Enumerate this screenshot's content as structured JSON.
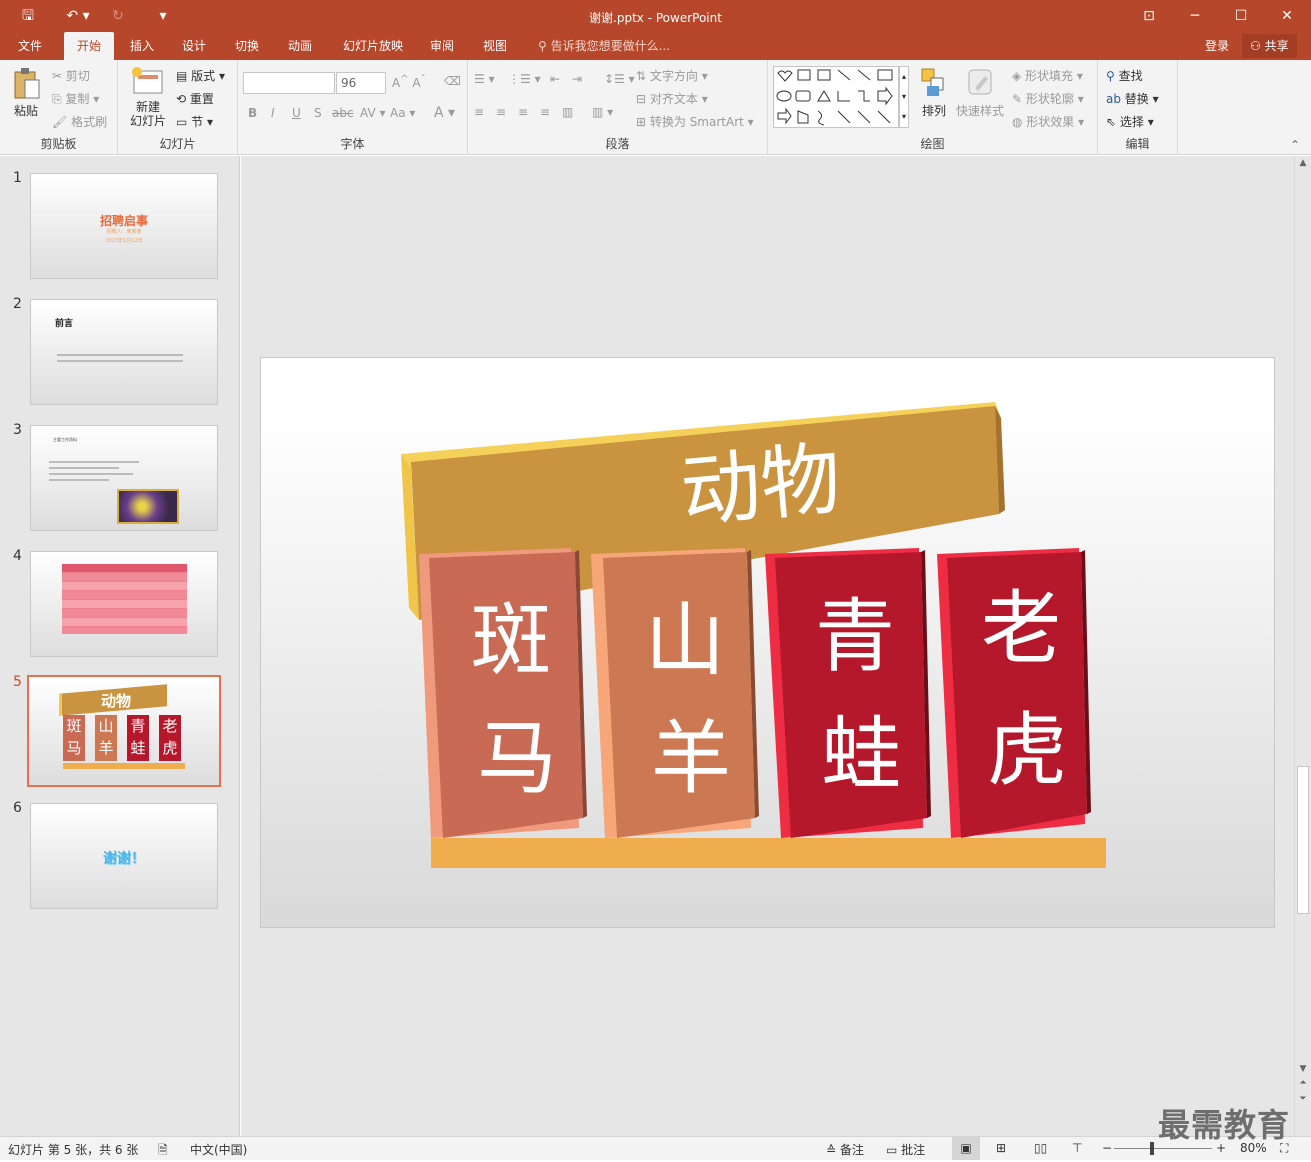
{
  "window": {
    "title": "谢谢.pptx - PowerPoint",
    "qat": {
      "save": "🖫",
      "undo": "↶ ▾",
      "redo": "↻",
      "customize": "▾"
    },
    "controls": {
      "ribbon_display": "⊡",
      "minimize": "─",
      "maximize": "☐",
      "close": "✕"
    }
  },
  "menu": {
    "tabs": [
      "文件",
      "开始",
      "插入",
      "设计",
      "切换",
      "动画",
      "幻灯片放映",
      "审阅",
      "视图"
    ],
    "active": "开始",
    "tell_me": "告诉我您想要做什么...",
    "login": "登录",
    "share": "共享"
  },
  "ribbon": {
    "clipboard": {
      "label": "剪贴板",
      "paste": "粘贴",
      "cut": "剪切",
      "copy": "复制",
      "format_painter": "格式刷"
    },
    "slides": {
      "label": "幻灯片",
      "new_slide": "新建\n幻灯片",
      "layout": "版式",
      "reset": "重置",
      "section": "节"
    },
    "font": {
      "label": "字体",
      "font_name": "",
      "font_size": "96"
    },
    "paragraph": {
      "label": "段落",
      "text_direction": "文字方向",
      "align_text": "对齐文本",
      "convert_smartart": "转换为 SmartArt"
    },
    "drawing": {
      "label": "绘图",
      "arrange": "排列",
      "quick_styles": "快速样式",
      "shape_fill": "形状填充",
      "shape_outline": "形状轮廓",
      "shape_effects": "形状效果"
    },
    "editing": {
      "label": "编辑",
      "find": "查找",
      "replace": "替换",
      "select": "选择"
    }
  },
  "thumbnails": [
    {
      "num": "1",
      "title": "招聘启事",
      "line1": "招聘人：某某某",
      "line2": "2023年1月12日"
    },
    {
      "num": "2",
      "title": "前言"
    },
    {
      "num": "3",
      "title": "主要工作资料"
    },
    {
      "num": "4",
      "title": "表格"
    },
    {
      "num": "5",
      "title": "动物",
      "cards": [
        "斑马",
        "山羊",
        "青蛙",
        "老虎"
      ]
    },
    {
      "num": "6",
      "title": "谢谢！"
    }
  ],
  "selected_slide": "5",
  "slide": {
    "banner": "动物",
    "cards": [
      {
        "line1": "斑",
        "line2": "马",
        "color": "#c96a55",
        "edge": "#f09a7d"
      },
      {
        "line1": "山",
        "line2": "羊",
        "color": "#cc7853",
        "edge": "#f7a67a"
      },
      {
        "line1": "青",
        "line2": "蛙",
        "color": "#b5172b",
        "edge": "#ee2d45"
      },
      {
        "line1": "老",
        "line2": "虎",
        "color": "#b5172b",
        "edge": "#ee2d45"
      }
    ],
    "banner_color": "#c9933f",
    "base_color": "#f0ad4e"
  },
  "status": {
    "slide_info": "幻灯片 第 5 张，共 6 张",
    "language": "中文(中国)",
    "notes": "备注",
    "comments": "批注",
    "zoom": "80%"
  },
  "watermark": "最需教育"
}
